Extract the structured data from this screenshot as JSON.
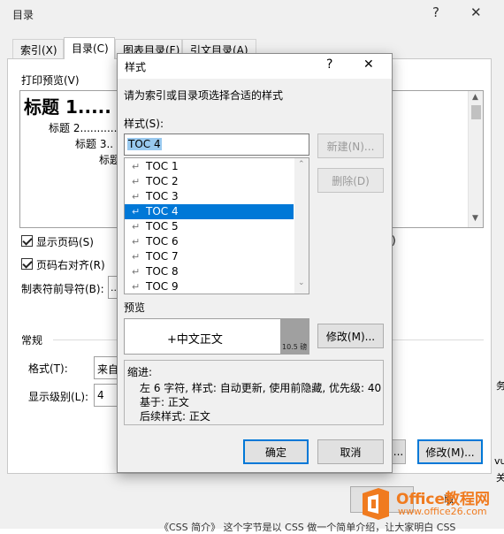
{
  "outer_dialog": {
    "title": "目录",
    "help_glyph": "?",
    "close_glyph": "✕",
    "tabs": [
      "索引(X)",
      "目录(C)",
      "图表目录(F)",
      "引文目录(A)"
    ],
    "print_preview_label": "打印预览(V)",
    "preview_lines": [
      "标题 1.....",
      "标题 2...........",
      "标题 3..",
      "标题"
    ],
    "show_page_numbers": "显示页码(S)",
    "right_align_page_numbers": "页码右对齐(R)",
    "tab_leader_label": "制表符前导符(B):",
    "tab_leader_value": "..",
    "general_label": "常规",
    "format_label": "格式(T):",
    "format_value": "来自",
    "show_levels_label": "显示级别(L):",
    "show_levels_value": "4",
    "right_paren": ")",
    "modify_button": "修改(M)...",
    "partial_button": "...",
    "cancel_partial": "取",
    "side_text": [
      "务",
      "vu",
      "关"
    ],
    "bottom_text": "《CSS 简介》 这个字节是以 CSS 做一个简单介绍，让大家明白 CSS"
  },
  "style_dialog": {
    "title": "样式",
    "help_glyph": "?",
    "close_glyph": "✕",
    "instruction": "请为索引或目录项选择合适的样式",
    "style_label": "样式(S):",
    "style_input_value": "TOC 4",
    "style_list": [
      "TOC 1",
      "TOC 2",
      "TOC 3",
      "TOC 4",
      "TOC 5",
      "TOC 6",
      "TOC 7",
      "TOC 8",
      "TOC 9"
    ],
    "selected_index": 3,
    "new_button": "新建(N)...",
    "delete_button": "删除(D)",
    "preview_label": "预览",
    "preview_text": "+中文正文",
    "preview_size": "10.5 磅",
    "modify_button": "修改(M)...",
    "description_title": "缩进:",
    "description_lines": [
      "左  6 字符, 样式: 自动更新, 使用前隐藏, 优先级: 40",
      "基于: 正文",
      "后续样式: 正文"
    ],
    "ok_button": "确定",
    "cancel_button": "取消"
  },
  "watermark": {
    "brand": "Office教程网",
    "url": "www.office26.com"
  },
  "colors": {
    "accent": "#0078d7",
    "watermark_orange": "#f07b1f"
  }
}
